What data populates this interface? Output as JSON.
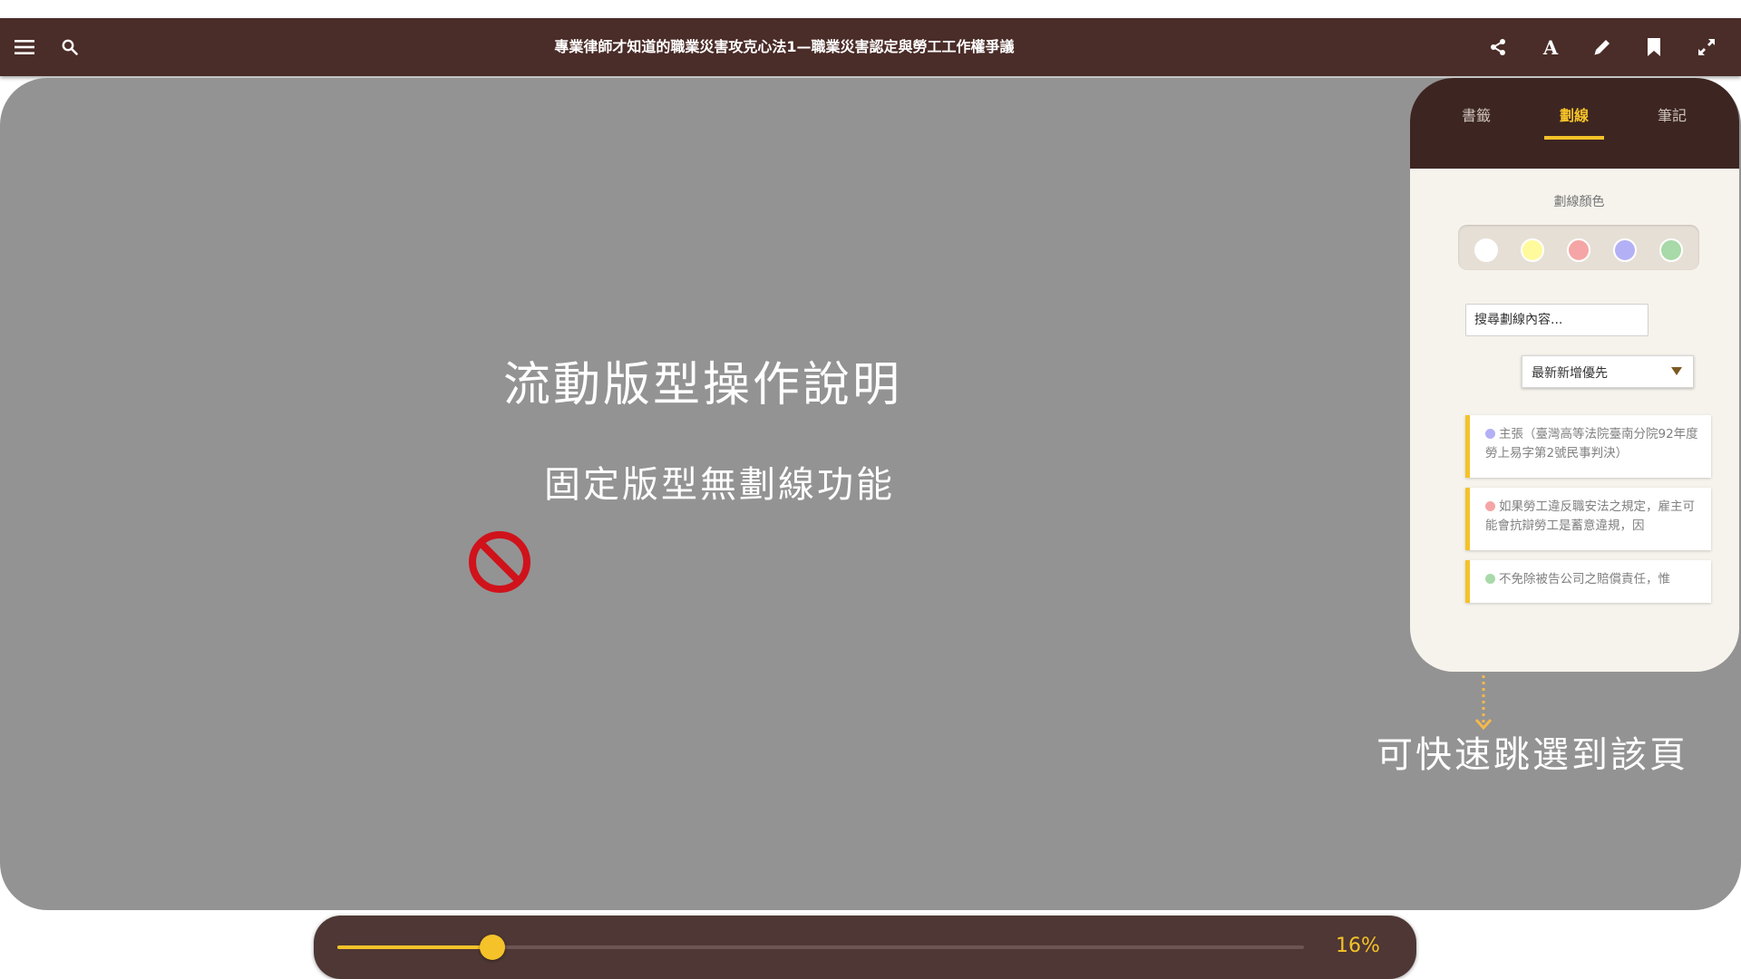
{
  "book_title": "專業律師才知道的職業災害攻克心法1—職業災害認定與勞工工作權爭議",
  "toolbar_icons": {
    "left": [
      "menu-icon",
      "search-icon"
    ],
    "right": [
      "share-icon",
      "font-icon",
      "pencil-icon",
      "bookmark-icon",
      "fullscreen-icon"
    ]
  },
  "guide": {
    "title": "流動版型操作說明",
    "notice": "固定版型無劃線功能",
    "jump_hint": "可快速跳選到該頁"
  },
  "panel": {
    "tabs": [
      {
        "label": "書籤",
        "active": false
      },
      {
        "label": "劃線",
        "active": true
      },
      {
        "label": "筆記",
        "active": false
      }
    ],
    "color_label": "劃線顏色",
    "colors": [
      "#ffffff",
      "#fffa9c",
      "#f5a5a5",
      "#b3b0f5",
      "#a8d9a8"
    ],
    "search_placeholder": "搜尋劃線內容...",
    "sort_label": "最新新增優先",
    "highlights": [
      {
        "color": "#b3b0f5",
        "text": "主張（臺灣高等法院臺南分院92年度勞上易字第2號民事判決）"
      },
      {
        "color": "#f5a5a5",
        "text": "如果勞工違反職安法之規定，雇主可能會抗辯勞工是蓄意違規，因"
      },
      {
        "color": "#a8d9a8",
        "text": "不免除被告公司之賠償責任，惟"
      }
    ]
  },
  "progress": {
    "percent": 16,
    "label": "16%",
    "accent": "#f5c229"
  },
  "colors": {
    "topbar": "#4a2c28",
    "panel_header": "#3d2622",
    "accent": "#f5c229",
    "overlay": "#939393"
  }
}
